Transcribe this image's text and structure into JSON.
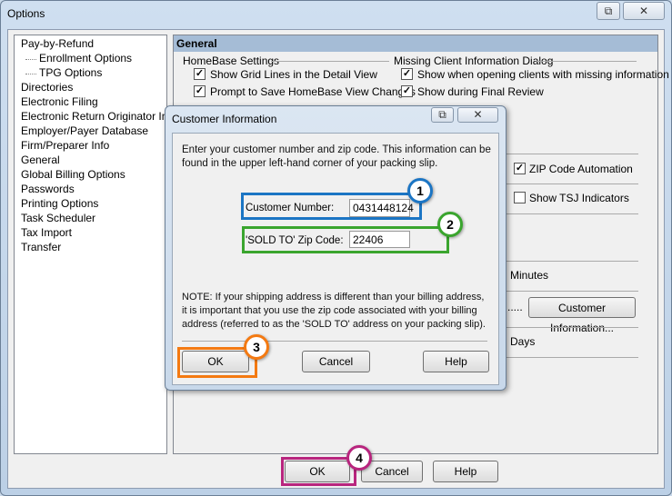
{
  "window": {
    "title": "Options"
  },
  "sidebar": {
    "items": [
      {
        "label": "Pay-by-Refund",
        "sub": false
      },
      {
        "label": "Enrollment Options",
        "sub": true
      },
      {
        "label": "TPG Options",
        "sub": true
      },
      {
        "label": "Directories",
        "sub": false
      },
      {
        "label": "Electronic Filing",
        "sub": false
      },
      {
        "label": "Electronic Return Originator Info",
        "sub": false
      },
      {
        "label": "Employer/Payer Database",
        "sub": false
      },
      {
        "label": "Firm/Preparer Info",
        "sub": false
      },
      {
        "label": "General",
        "sub": false
      },
      {
        "label": "Global Billing Options",
        "sub": false
      },
      {
        "label": "Passwords",
        "sub": false
      },
      {
        "label": "Printing Options",
        "sub": false
      },
      {
        "label": "Task Scheduler",
        "sub": false
      },
      {
        "label": "Tax Import",
        "sub": false
      },
      {
        "label": "Transfer",
        "sub": false
      }
    ]
  },
  "panel": {
    "title": "General",
    "homebase": {
      "label": "HomeBase Settings",
      "opt1": "Show Grid Lines in the Detail View",
      "opt2": "Prompt to Save HomeBase View Changes"
    },
    "missing": {
      "label": "Missing Client Information Dialog",
      "opt1": "Show when opening clients with missing information",
      "opt2": "Show during Final Review"
    },
    "zip_auto": "ZIP Code Automation",
    "tsj": "Show TSJ Indicators",
    "minutes": "Minutes",
    "dots": ".....",
    "customer_info_button": "Customer Information...",
    "days": "Days"
  },
  "footer": {
    "ok": "OK",
    "cancel": "Cancel",
    "help": "Help"
  },
  "dialog": {
    "title": "Customer Information",
    "intro": "Enter your customer number and zip code. This information can be found in the upper left-hand corner of your packing slip.",
    "customer_number_label": "Customer Number:",
    "customer_number_value": "0431448124",
    "zip_label": "'SOLD TO' Zip Code:",
    "zip_value": "22406",
    "note": "NOTE: If your shipping address is different than your billing address, it is important that you use the zip code associated with your billing address (referred to as the 'SOLD TO' address on your packing slip).",
    "ok": "OK",
    "cancel": "Cancel",
    "help": "Help"
  },
  "callouts": [
    {
      "n": "1",
      "color": "#1b75c4"
    },
    {
      "n": "2",
      "color": "#3aa52e"
    },
    {
      "n": "3",
      "color": "#f47a12"
    },
    {
      "n": "4",
      "color": "#b8257e"
    }
  ]
}
